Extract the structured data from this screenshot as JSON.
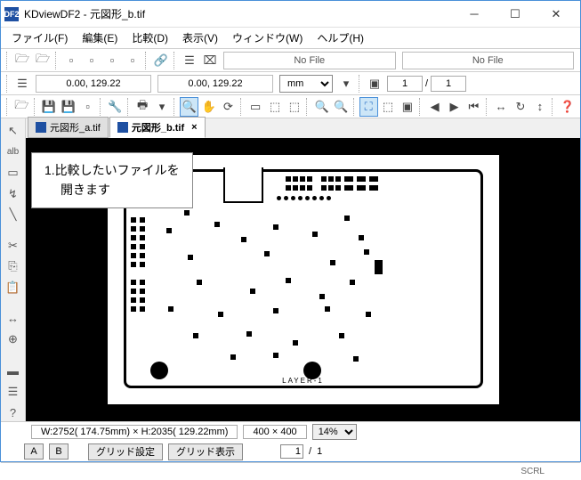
{
  "title": "KDviewDF2 - 元図形_b.tif",
  "menu": {
    "file": "ファイル(F)",
    "edit": "編集(E)",
    "compare": "比較(D)",
    "view": "表示(V)",
    "window": "ウィンドウ(W)",
    "help": "ヘルプ(H)"
  },
  "toolbar1": {
    "nofile1": "No File",
    "nofile2": "No File"
  },
  "toolbar2": {
    "coord1": "0.00, 129.22",
    "coord2": "0.00, 129.22",
    "unit": "mm",
    "page": "1",
    "pagesep": "/",
    "totalpages": "1"
  },
  "tabs": {
    "a": "元図形_a.tif",
    "b": "元図形_b.tif"
  },
  "tooltip": {
    "line1": "1.比較したいファイルを",
    "line2": "開きます"
  },
  "drawing": {
    "layer": "LAYER-1"
  },
  "status1": {
    "dims": "W:2752( 174.75mm) × H:2035( 129.22mm)",
    "dpi": "400 × 400",
    "zoom": "14%"
  },
  "status2": {
    "a": "A",
    "b": "B",
    "gridset": "グリッド設定",
    "gridshow": "グリッド表示",
    "curpage": "1",
    "sep": "/",
    "total": "1"
  },
  "bottom": {
    "scrl": "SCRL"
  }
}
